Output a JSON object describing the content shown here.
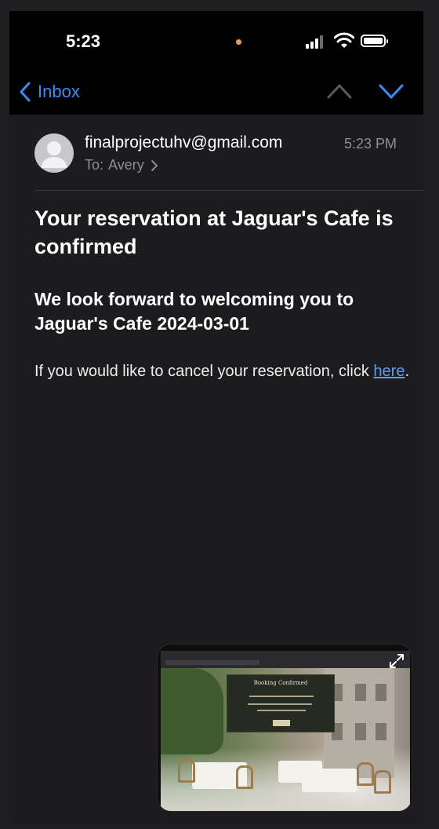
{
  "status_bar": {
    "time": "5:23"
  },
  "nav": {
    "back_label": "Inbox"
  },
  "message": {
    "sender": "finalprojectuhv@gmail.com",
    "time": "5:23 PM",
    "to_label": "To:",
    "to_name": "Avery",
    "subject": "Your reservation at Jaguar's Cafe is confirmed",
    "heading": "We look forward to welcoming you to Jaguar's Cafe 2024-03-01",
    "body_prefix": "If you would like to cancel your reservation, click ",
    "link_text": "here",
    "body_suffix": "."
  },
  "pip": {
    "dialog_title": "Booking Confirmed"
  },
  "colors": {
    "accent": "#3a8cf5",
    "link": "#5b9cf0",
    "background": "#1c1c1e"
  }
}
